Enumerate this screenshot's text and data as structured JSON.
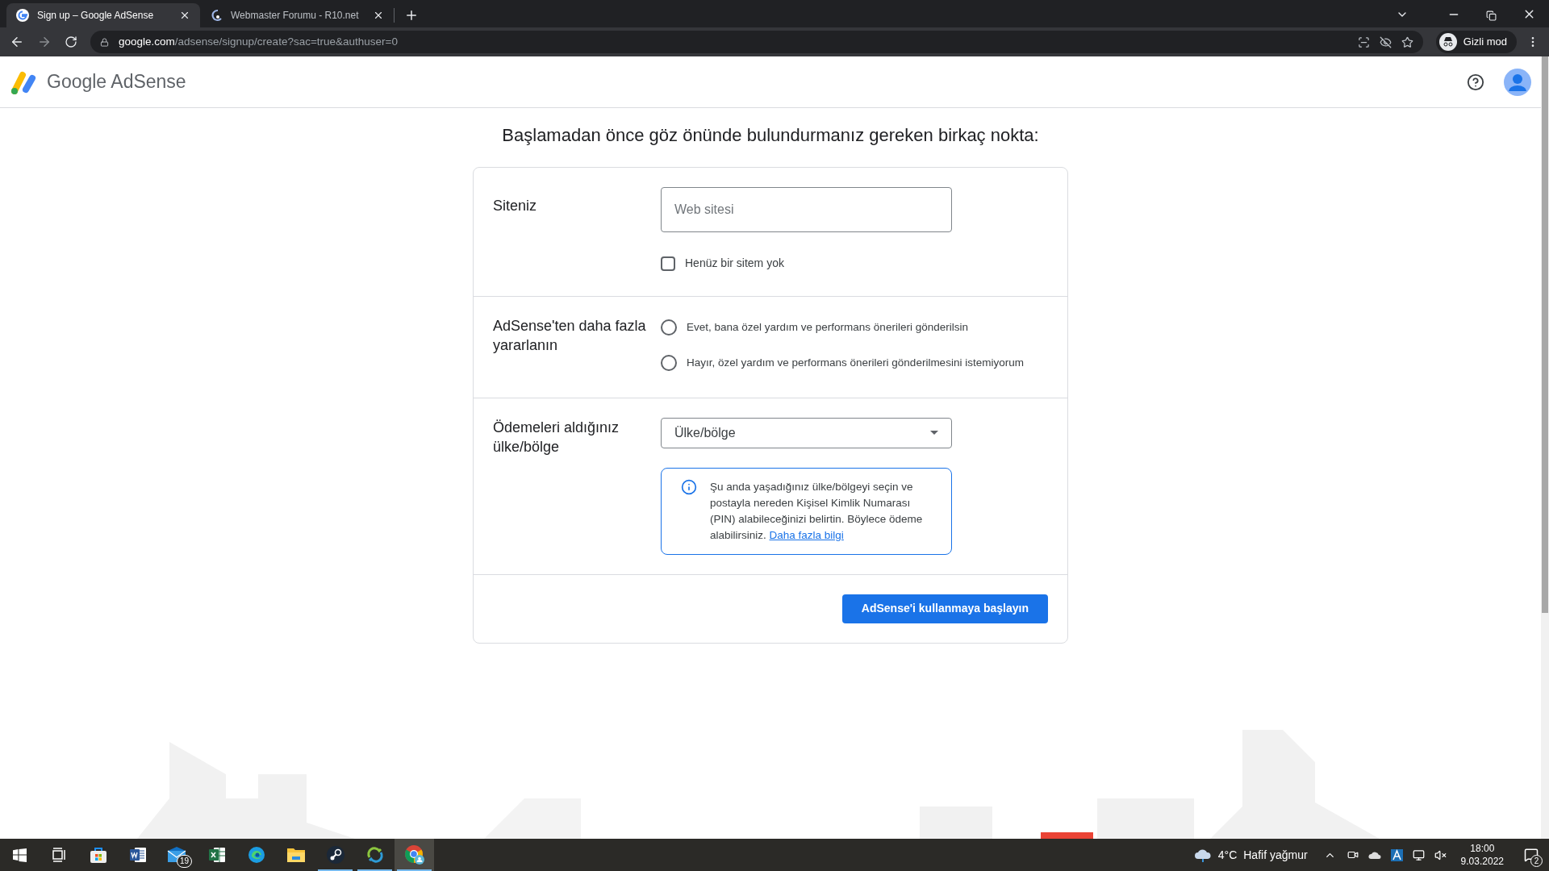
{
  "browser": {
    "tabs": [
      {
        "title": "Sign up – Google AdSense",
        "selected": true,
        "kind": "google"
      },
      {
        "title": "Webmaster Forumu - R10.net",
        "selected": false,
        "kind": "forum"
      }
    ],
    "url": {
      "domain": "google.com",
      "path": "/adsense/signup/create?sac=true&authuser=0"
    },
    "profile": "Gizli mod"
  },
  "page": {
    "brand": {
      "word1": "Google",
      "word2": "AdSense"
    },
    "heading": "Başlamadan önce göz önünde bulundurmanız gereken birkaç nokta:",
    "site": {
      "label": "Siteniz",
      "placeholder": "Web sitesi",
      "checkbox": {
        "label": "Henüz bir sitem yok",
        "checked": false
      }
    },
    "more": {
      "label": "AdSense'ten daha fazla yararlanın",
      "options": [
        {
          "label": "Evet, bana özel yardım ve performans önerileri gönderilsin",
          "selected": false
        },
        {
          "label": "Hayır, özel yardım ve performans önerileri gönderilmesini istemiyorum",
          "selected": false
        }
      ]
    },
    "payment": {
      "label": "Ödemeleri aldığınız ülke/bölge",
      "select": "Ülke/bölge",
      "info": {
        "text": "Şu anda yaşadığınız ülke/bölgeyi seçin ve postayla nereden Kişisel Kimlik Numarası (PIN) alabileceğinizi belirtin. Böylece ödeme alabilirsiniz.",
        "link": "Daha fazla bilgi"
      }
    },
    "button": "AdSense'i kullanmaya başlayın"
  },
  "taskbar": {
    "apps": [
      {
        "kind": "taskview",
        "running": false,
        "active": false
      },
      {
        "kind": "store",
        "running": false,
        "active": false
      },
      {
        "kind": "word",
        "running": false,
        "active": false
      },
      {
        "kind": "mail",
        "running": false,
        "active": false,
        "badge": "19"
      },
      {
        "kind": "excel",
        "running": false,
        "active": false
      },
      {
        "kind": "edge",
        "running": false,
        "active": false
      },
      {
        "kind": "folder",
        "running": false,
        "active": false
      },
      {
        "kind": "steam",
        "running": true,
        "active": false
      },
      {
        "kind": "sync",
        "running": true,
        "active": false
      },
      {
        "kind": "chrome",
        "running": true,
        "active": true
      }
    ],
    "weather": {
      "temp": "4°C",
      "desc": "Hafif yağmur"
    },
    "clock": {
      "time": "18:00",
      "date": "9.03.2022"
    },
    "notifications": "2"
  }
}
